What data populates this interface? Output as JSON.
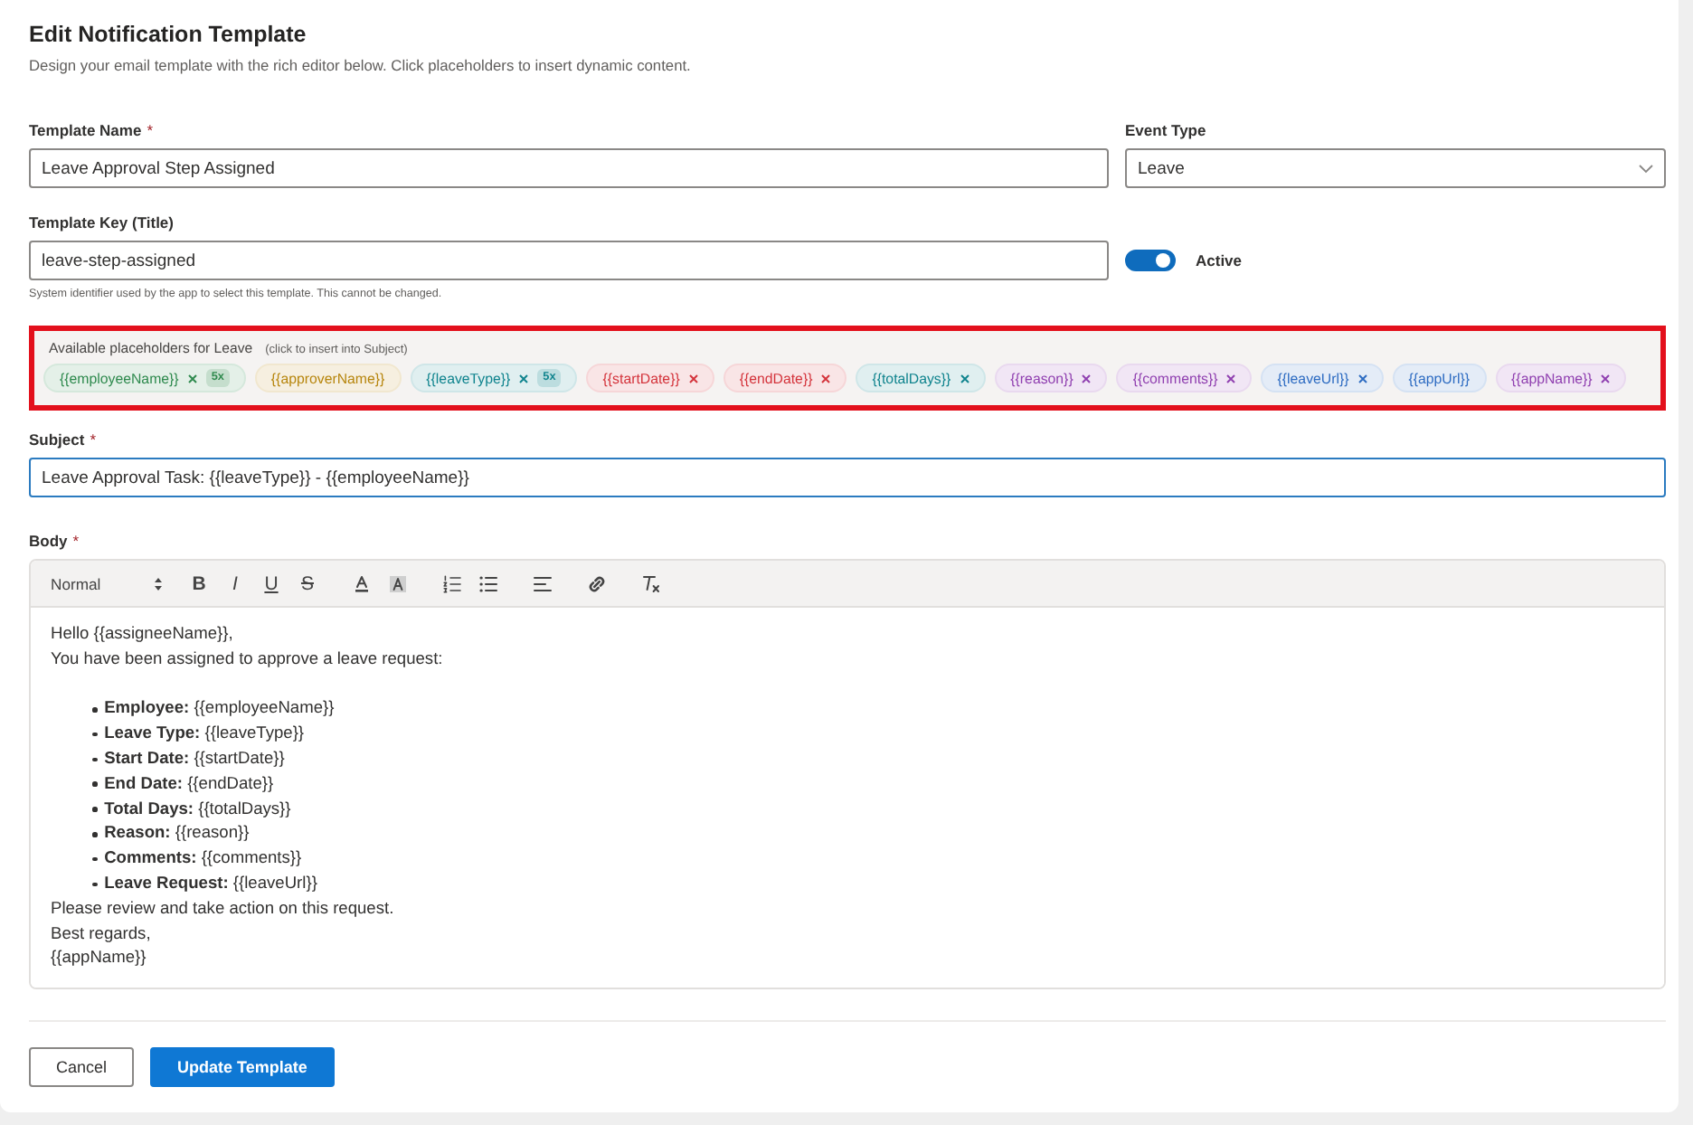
{
  "header": {
    "title": "Edit Notification Template",
    "subtitle": "Design your email template with the rich editor below. Click placeholders to insert dynamic content."
  },
  "fields": {
    "template_name": {
      "label": "Template Name",
      "required_mark": "*",
      "value": "Leave Approval Step Assigned"
    },
    "event_type": {
      "label": "Event Type",
      "value": "Leave"
    },
    "template_key": {
      "label": "Template Key (Title)",
      "value": "leave-step-assigned",
      "hint": "System identifier used by the app to select this template. This cannot be changed."
    },
    "active": {
      "label": "Active",
      "on": true
    }
  },
  "placeholders": {
    "highlighted": true,
    "title": "Available placeholders for Leave",
    "note": "(click to insert into Subject)",
    "chips": [
      {
        "text": "{{employeeName}}",
        "color": "#2f8a4e",
        "removable": true,
        "count": "5x"
      },
      {
        "text": "{{approverName}}",
        "color": "#b7860e",
        "removable": false
      },
      {
        "text": "{{leaveType}}",
        "color": "#10848e",
        "removable": true,
        "count": "5x"
      },
      {
        "text": "{{startDate}}",
        "color": "#d4343c",
        "removable": true
      },
      {
        "text": "{{endDate}}",
        "color": "#d4343c",
        "removable": true
      },
      {
        "text": "{{totalDays}}",
        "color": "#10848e",
        "removable": true
      },
      {
        "text": "{{reason}}",
        "color": "#9040b0",
        "removable": true
      },
      {
        "text": "{{comments}}",
        "color": "#9040b0",
        "removable": true
      },
      {
        "text": "{{leaveUrl}}",
        "color": "#2e6cc2",
        "removable": true
      },
      {
        "text": "{{appUrl}}",
        "color": "#2e6cc2",
        "removable": false
      },
      {
        "text": "{{appName}}",
        "color": "#9040b0",
        "removable": true
      }
    ]
  },
  "subject": {
    "label": "Subject",
    "required_mark": "*",
    "value": "Leave Approval Task: {{leaveType}} - {{employeeName}}",
    "focused": true
  },
  "body": {
    "label": "Body",
    "required_mark": "*",
    "toolbar": {
      "heading": "Normal",
      "letters": [
        {
          "label": "B",
          "kind": "bold"
        },
        {
          "label": "I",
          "kind": "italic"
        },
        {
          "label": "U",
          "kind": "underline"
        },
        {
          "label": "S",
          "kind": "strike"
        }
      ]
    },
    "intro": [
      "Hello {{assigneeName}},",
      "You have been assigned to approve a leave request:"
    ],
    "list": [
      "**Employee:** {{employeeName}}",
      "**Leave Type:** {{leaveType}}",
      "**Start Date:** {{startDate}}",
      "**End Date:** {{endDate}}",
      "**Total Days:** {{totalDays}}",
      "**Reason:** {{reason}}",
      "**Comments:** {{comments}}",
      "**Leave Request:** {{leaveUrl}}"
    ],
    "outro": [
      "Please review and take action on this request.",
      "Best regards,",
      "{{appName}}"
    ]
  },
  "buttons": [
    {
      "label": "Cancel",
      "kind": "secondary"
    },
    {
      "label": "Update Template",
      "kind": "primary"
    }
  ]
}
